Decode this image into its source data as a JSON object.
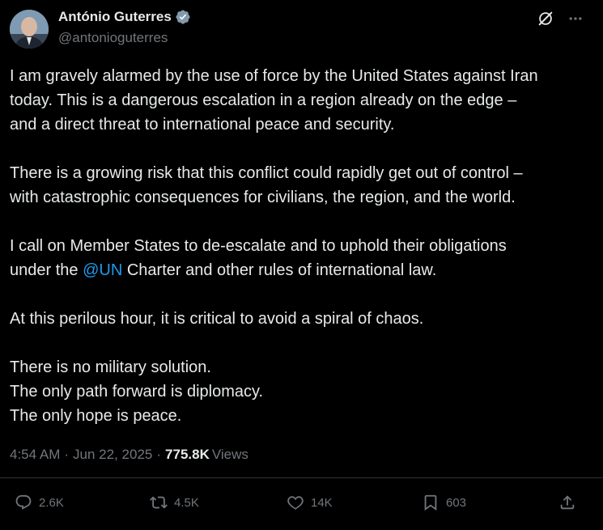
{
  "author": {
    "display_name": "António Guterres",
    "handle": "@antonioguterres",
    "verified_badge_color": "#829aab"
  },
  "top_icons": [
    "grok-icon",
    "more-options-icon"
  ],
  "tweet": {
    "paragraphs": [
      [
        "I am gravely alarmed by the use of force by the United States against Iran",
        "today. This is a dangerous escalation in a region already on the edge –",
        "and a direct threat to international peace and security."
      ],
      [
        "There is a growing risk that this conflict could rapidly get out of control –",
        "with catastrophic consequences for civilians, the region, and the world."
      ],
      [
        "I call on Member States to de-escalate and to uphold their obligations"
      ],
      [
        "At this perilous hour, it is critical to avoid a spiral of chaos."
      ],
      [
        "There is no military solution.",
        "The only path forward is diplomacy.",
        "The only hope is peace."
      ]
    ],
    "line_with_mention": {
      "before": "under the ",
      "mention": "@UN",
      "after": " Charter and other rules of international law."
    },
    "mention_color": "#1d9bf0"
  },
  "meta": {
    "time": "4:54 AM",
    "date": "Jun 22, 2025",
    "views_count": "775.8K",
    "views_label": "Views"
  },
  "actions": {
    "reply_count": "2.6K",
    "repost_count": "4.5K",
    "like_count": "14K",
    "bookmark_count": "603"
  },
  "colors": {
    "background": "#000000",
    "text": "#e7e9ea",
    "secondary": "#71767b",
    "divider": "#2f3336"
  }
}
